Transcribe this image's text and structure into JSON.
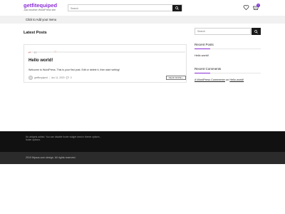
{
  "header": {
    "site_title": "getfitequiped",
    "tagline": "Just another WordPress site",
    "search_placeholder": "Search",
    "cart_count": "0",
    "accent_color": "#8b2bd6"
  },
  "menu": {
    "add_menu_label": "Click to Add your menu"
  },
  "main": {
    "section_title": "Latest Posts",
    "post": {
      "title": "Hello world!",
      "excerpt": "Welcome to WordPress. This is your first post. Edit or delete it, then start writing!",
      "author": "getfitequiped",
      "date": "Jun 11, 2020",
      "comments": "0",
      "read_more": "READ MORE »"
    }
  },
  "sidebar": {
    "search_placeholder": "Search",
    "recent_posts_title": "Recent Posts",
    "recent_posts": [
      "Hello world!"
    ],
    "recent_comments_title": "Recent Comments",
    "recent_comment": {
      "author": "A WordPress Commenter",
      "on_word": "on",
      "post": "Hello world!"
    }
  },
  "footer": {
    "widget_note": "No widgets added. You can disable footer widget area in theme options - footer options.",
    "copyright": "2019 fitpaus.com design. All rights reserved."
  }
}
